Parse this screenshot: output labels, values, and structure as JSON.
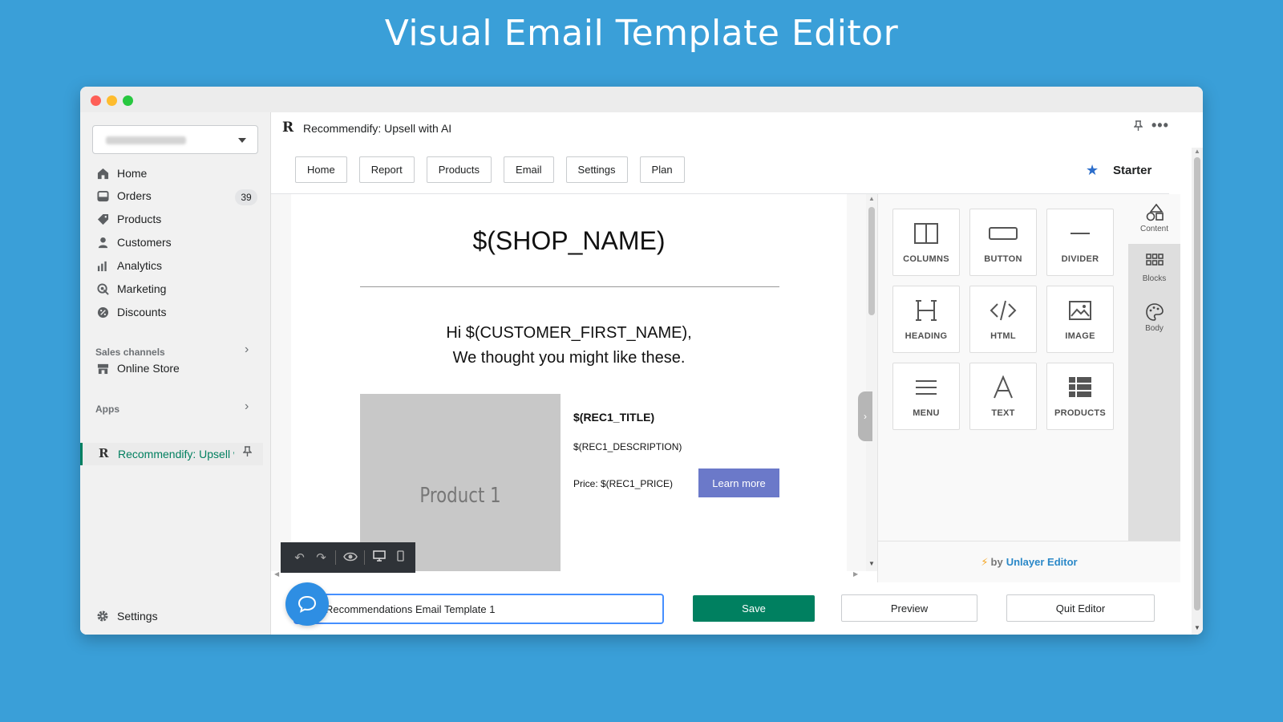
{
  "hero": {
    "title": "Visual Email Template Editor"
  },
  "sidebar": {
    "nav": [
      {
        "label": "Home",
        "icon": "home-icon"
      },
      {
        "label": "Orders",
        "icon": "orders-icon",
        "badge": "39"
      },
      {
        "label": "Products",
        "icon": "tag-icon"
      },
      {
        "label": "Customers",
        "icon": "person-icon"
      },
      {
        "label": "Analytics",
        "icon": "bar-chart-icon"
      },
      {
        "label": "Marketing",
        "icon": "target-icon"
      },
      {
        "label": "Discounts",
        "icon": "discount-icon"
      }
    ],
    "sales_channels_label": "Sales channels",
    "online_store_label": "Online Store",
    "apps_label": "Apps",
    "active_app_label": "Recommendify: Upsell with AI",
    "settings_label": "Settings"
  },
  "app": {
    "name": "Recommendify: Upsell with AI",
    "tabs": [
      "Home",
      "Report",
      "Products",
      "Email",
      "Settings",
      "Plan"
    ],
    "plan": "Starter"
  },
  "email": {
    "shop_name": "$(SHOP_NAME)",
    "greeting_line1": "Hi $(CUSTOMER_FIRST_NAME),",
    "greeting_line2": "We thought you might like these.",
    "product_placeholder": "Product 1",
    "rec_title": "$(REC1_TITLE)",
    "rec_description": "$(REC1_DESCRIPTION)",
    "rec_price": "Price: $(REC1_PRICE)",
    "learn_more": "Learn more"
  },
  "panel": {
    "tools": [
      "COLUMNS",
      "BUTTON",
      "DIVIDER",
      "HEADING",
      "HTML",
      "IMAGE",
      "MENU",
      "TEXT",
      "PRODUCTS"
    ],
    "rail": [
      "Content",
      "Blocks",
      "Body"
    ],
    "footer_by": "by",
    "footer_brand": "Unlayer Editor"
  },
  "footer": {
    "template_name_value": "Recommendations Email Template 1",
    "save_label": "Save",
    "preview_label": "Preview",
    "quit_label": "Quit Editor"
  }
}
